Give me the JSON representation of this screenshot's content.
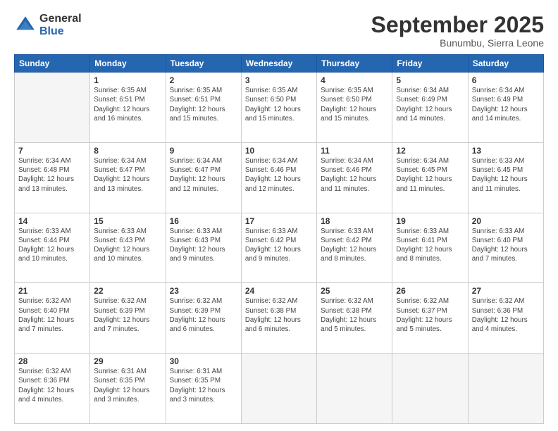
{
  "logo": {
    "general": "General",
    "blue": "Blue"
  },
  "title": "September 2025",
  "subtitle": "Bunumbu, Sierra Leone",
  "days_header": [
    "Sunday",
    "Monday",
    "Tuesday",
    "Wednesday",
    "Thursday",
    "Friday",
    "Saturday"
  ],
  "weeks": [
    [
      {
        "day": "",
        "info": ""
      },
      {
        "day": "1",
        "info": "Sunrise: 6:35 AM\nSunset: 6:51 PM\nDaylight: 12 hours\nand 16 minutes."
      },
      {
        "day": "2",
        "info": "Sunrise: 6:35 AM\nSunset: 6:51 PM\nDaylight: 12 hours\nand 15 minutes."
      },
      {
        "day": "3",
        "info": "Sunrise: 6:35 AM\nSunset: 6:50 PM\nDaylight: 12 hours\nand 15 minutes."
      },
      {
        "day": "4",
        "info": "Sunrise: 6:35 AM\nSunset: 6:50 PM\nDaylight: 12 hours\nand 15 minutes."
      },
      {
        "day": "5",
        "info": "Sunrise: 6:34 AM\nSunset: 6:49 PM\nDaylight: 12 hours\nand 14 minutes."
      },
      {
        "day": "6",
        "info": "Sunrise: 6:34 AM\nSunset: 6:49 PM\nDaylight: 12 hours\nand 14 minutes."
      }
    ],
    [
      {
        "day": "7",
        "info": "Sunrise: 6:34 AM\nSunset: 6:48 PM\nDaylight: 12 hours\nand 13 minutes."
      },
      {
        "day": "8",
        "info": "Sunrise: 6:34 AM\nSunset: 6:47 PM\nDaylight: 12 hours\nand 13 minutes."
      },
      {
        "day": "9",
        "info": "Sunrise: 6:34 AM\nSunset: 6:47 PM\nDaylight: 12 hours\nand 12 minutes."
      },
      {
        "day": "10",
        "info": "Sunrise: 6:34 AM\nSunset: 6:46 PM\nDaylight: 12 hours\nand 12 minutes."
      },
      {
        "day": "11",
        "info": "Sunrise: 6:34 AM\nSunset: 6:46 PM\nDaylight: 12 hours\nand 11 minutes."
      },
      {
        "day": "12",
        "info": "Sunrise: 6:34 AM\nSunset: 6:45 PM\nDaylight: 12 hours\nand 11 minutes."
      },
      {
        "day": "13",
        "info": "Sunrise: 6:33 AM\nSunset: 6:45 PM\nDaylight: 12 hours\nand 11 minutes."
      }
    ],
    [
      {
        "day": "14",
        "info": "Sunrise: 6:33 AM\nSunset: 6:44 PM\nDaylight: 12 hours\nand 10 minutes."
      },
      {
        "day": "15",
        "info": "Sunrise: 6:33 AM\nSunset: 6:43 PM\nDaylight: 12 hours\nand 10 minutes."
      },
      {
        "day": "16",
        "info": "Sunrise: 6:33 AM\nSunset: 6:43 PM\nDaylight: 12 hours\nand 9 minutes."
      },
      {
        "day": "17",
        "info": "Sunrise: 6:33 AM\nSunset: 6:42 PM\nDaylight: 12 hours\nand 9 minutes."
      },
      {
        "day": "18",
        "info": "Sunrise: 6:33 AM\nSunset: 6:42 PM\nDaylight: 12 hours\nand 8 minutes."
      },
      {
        "day": "19",
        "info": "Sunrise: 6:33 AM\nSunset: 6:41 PM\nDaylight: 12 hours\nand 8 minutes."
      },
      {
        "day": "20",
        "info": "Sunrise: 6:33 AM\nSunset: 6:40 PM\nDaylight: 12 hours\nand 7 minutes."
      }
    ],
    [
      {
        "day": "21",
        "info": "Sunrise: 6:32 AM\nSunset: 6:40 PM\nDaylight: 12 hours\nand 7 minutes."
      },
      {
        "day": "22",
        "info": "Sunrise: 6:32 AM\nSunset: 6:39 PM\nDaylight: 12 hours\nand 7 minutes."
      },
      {
        "day": "23",
        "info": "Sunrise: 6:32 AM\nSunset: 6:39 PM\nDaylight: 12 hours\nand 6 minutes."
      },
      {
        "day": "24",
        "info": "Sunrise: 6:32 AM\nSunset: 6:38 PM\nDaylight: 12 hours\nand 6 minutes."
      },
      {
        "day": "25",
        "info": "Sunrise: 6:32 AM\nSunset: 6:38 PM\nDaylight: 12 hours\nand 5 minutes."
      },
      {
        "day": "26",
        "info": "Sunrise: 6:32 AM\nSunset: 6:37 PM\nDaylight: 12 hours\nand 5 minutes."
      },
      {
        "day": "27",
        "info": "Sunrise: 6:32 AM\nSunset: 6:36 PM\nDaylight: 12 hours\nand 4 minutes."
      }
    ],
    [
      {
        "day": "28",
        "info": "Sunrise: 6:32 AM\nSunset: 6:36 PM\nDaylight: 12 hours\nand 4 minutes."
      },
      {
        "day": "29",
        "info": "Sunrise: 6:31 AM\nSunset: 6:35 PM\nDaylight: 12 hours\nand 3 minutes."
      },
      {
        "day": "30",
        "info": "Sunrise: 6:31 AM\nSunset: 6:35 PM\nDaylight: 12 hours\nand 3 minutes."
      },
      {
        "day": "",
        "info": ""
      },
      {
        "day": "",
        "info": ""
      },
      {
        "day": "",
        "info": ""
      },
      {
        "day": "",
        "info": ""
      }
    ]
  ]
}
